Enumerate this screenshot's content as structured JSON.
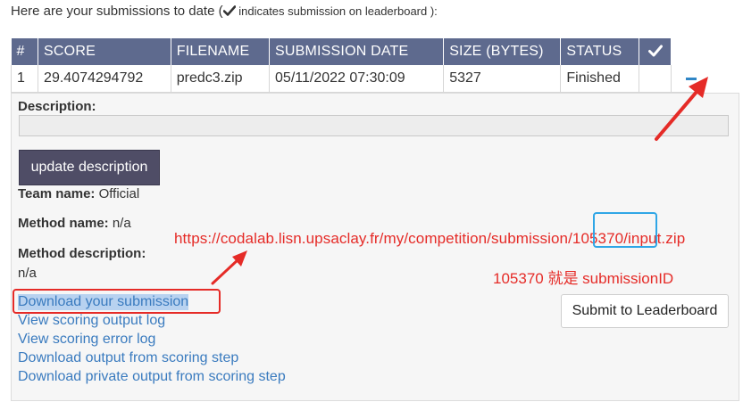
{
  "intro": {
    "prefix": "Here are your submissions to date (",
    "check_icon": "check-icon",
    "note": " indicates submission on leaderboard ):"
  },
  "table": {
    "headers": [
      "#",
      "SCORE",
      "FILENAME",
      "SUBMISSION DATE",
      "SIZE (BYTES)",
      "STATUS"
    ],
    "check_header_icon": "check-icon",
    "rows": [
      {
        "num": "1",
        "score": "29.4074294792",
        "filename": "predc3.zip",
        "date": "05/11/2022 07:30:09",
        "size": "5327",
        "status": "Finished",
        "on_leaderboard": ""
      }
    ]
  },
  "details": {
    "description_label": "Description:",
    "description_value": "",
    "update_button": "update description",
    "team_label": "Team name:",
    "team_value": "Official",
    "method_name_label": "Method name:",
    "method_name_value": "n/a",
    "method_desc_label": "Method description:",
    "method_desc_value": "n/a",
    "links": [
      "Download your submission",
      "View scoring output log",
      "View scoring error log",
      "Download output from scoring step",
      "Download private output from scoring step"
    ],
    "leaderboard_button": "Submit to Leaderboard"
  },
  "annotations": {
    "url": "https://codalab.lisn.upsaclay.fr/my/competition/submission/105370/input.zip",
    "note": "105370 就是 submissionID",
    "color": "#e52b27",
    "highlight_color": "#2fa6e6"
  }
}
